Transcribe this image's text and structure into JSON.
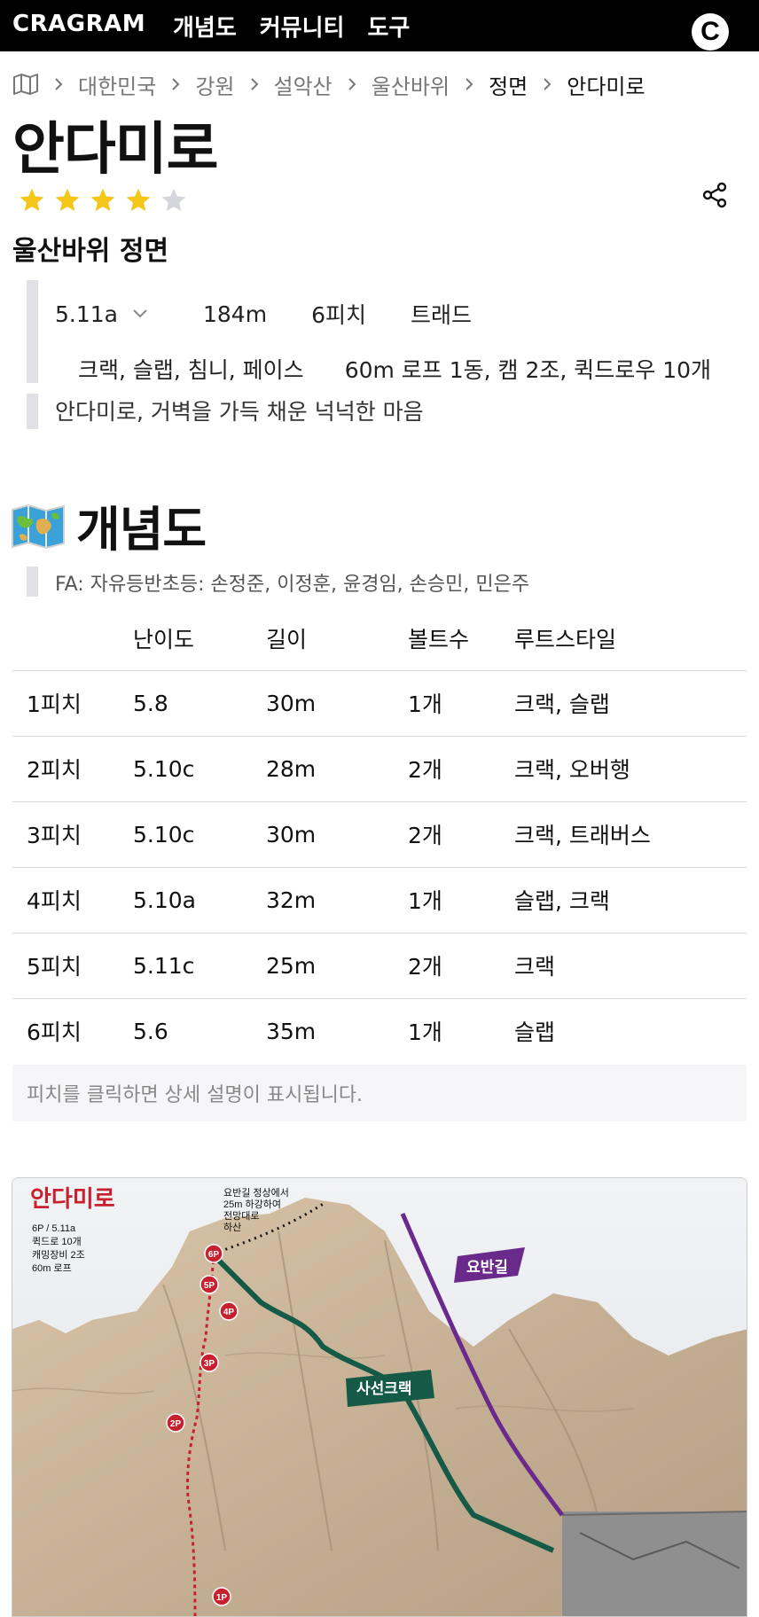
{
  "header": {
    "brand": "CRAGRAM",
    "nav": [
      "개념도",
      "커뮤니티",
      "도구"
    ],
    "logo_letter": "C"
  },
  "breadcrumb": [
    "대한민국",
    "강원",
    "설악산",
    "울산바위",
    "정면",
    "안다미로"
  ],
  "route": {
    "name": "안다미로",
    "rating": 4,
    "rating_max": 5,
    "wall": "울산바위 정면",
    "grade": "5.11a",
    "length": "184m",
    "pitches": "6피치",
    "style": "트래드",
    "features": "크랙, 슬랩, 침니, 페이스",
    "gear": "60m 로프 1동, 캠 2조, 퀵드로우 10개",
    "description": "안다미로, 거벽을 가득 채운 넉넉한 마음"
  },
  "topo_section": {
    "title": "개념도",
    "icon": "map-emoji-icon",
    "fa": "FA: 자유등반초등: 손정준, 이정훈, 윤경임, 손승민, 민은주",
    "columns": [
      "",
      "난이도",
      "길이",
      "볼트수",
      "루트스타일"
    ],
    "rows": [
      [
        "1피치",
        "5.8",
        "30m",
        "1개",
        "크랙, 슬랩"
      ],
      [
        "2피치",
        "5.10c",
        "28m",
        "2개",
        "크랙, 오버행"
      ],
      [
        "3피치",
        "5.10c",
        "30m",
        "2개",
        "크랙, 트래버스"
      ],
      [
        "4피치",
        "5.10a",
        "32m",
        "1개",
        "슬랩, 크랙"
      ],
      [
        "5피치",
        "5.11c",
        "25m",
        "2개",
        "크랙"
      ],
      [
        "6피치",
        "5.6",
        "35m",
        "1개",
        "슬랩"
      ]
    ],
    "note": "피치를 클릭하면 상세 설명이 표시됩니다."
  },
  "topo_image": {
    "title": "안다미로",
    "info_lines": [
      "6P / 5.11a",
      "퀵드로 10개",
      "캐밍장비 2조",
      "60m 로프"
    ],
    "descent_lines": [
      "요반길 정상에서",
      "25m 하강하여",
      "전망대로",
      "하산"
    ],
    "pitch_markers": [
      "6P",
      "5P",
      "4P",
      "3P",
      "2P",
      "1P"
    ],
    "label_purple": "요반길",
    "label_green": "사선크랙",
    "colors": {
      "purple": "#6a2a8c",
      "green": "#145a46",
      "red": "#c8202e",
      "rock": "#c9b49a"
    }
  }
}
